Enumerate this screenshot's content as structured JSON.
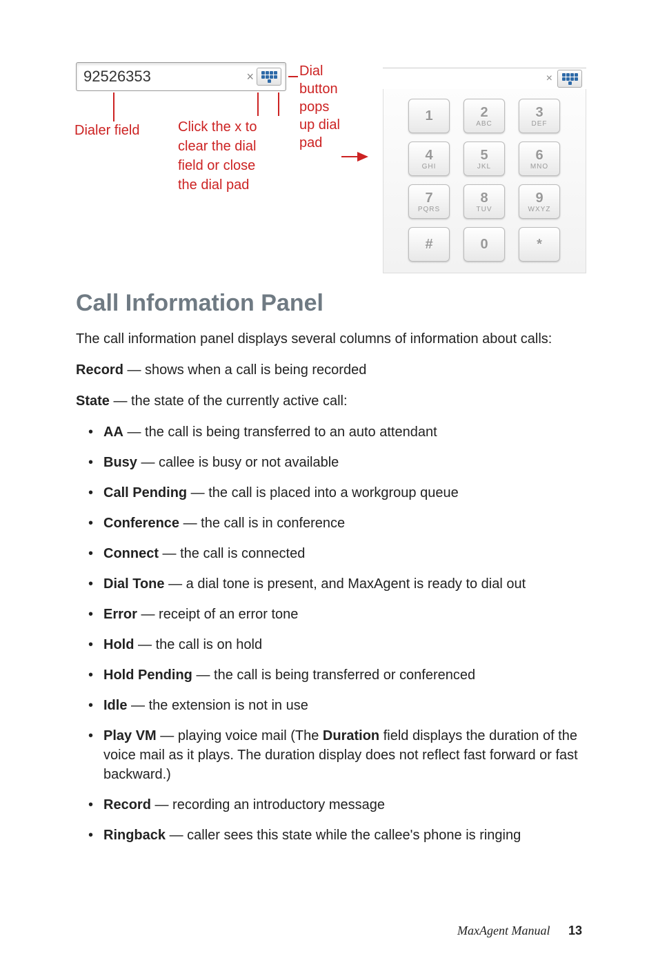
{
  "dialer": {
    "value": "92526353",
    "clear_glyph": "×"
  },
  "labels": {
    "dialer_field": "Dialer field",
    "click_x": "Click the x to clear the dial field or close the dial pad",
    "dial_button": "Dial button pops up dial pad"
  },
  "keypad": {
    "close_glyph": "×",
    "keys": [
      {
        "num": "1",
        "ltr": ""
      },
      {
        "num": "2",
        "ltr": "ABC"
      },
      {
        "num": "3",
        "ltr": "DEF"
      },
      {
        "num": "4",
        "ltr": "GHI"
      },
      {
        "num": "5",
        "ltr": "JKL"
      },
      {
        "num": "6",
        "ltr": "MNO"
      },
      {
        "num": "7",
        "ltr": "PQRS"
      },
      {
        "num": "8",
        "ltr": "TUV"
      },
      {
        "num": "9",
        "ltr": "WXYZ"
      },
      {
        "num": "#",
        "ltr": ""
      },
      {
        "num": "0",
        "ltr": ""
      },
      {
        "num": "*",
        "ltr": ""
      }
    ]
  },
  "section_heading": "Call Information Panel",
  "intro": "The call information panel displays several columns of information about calls:",
  "record_line": {
    "term": "Record",
    "dash": " — ",
    "desc": "shows when a call is being recorded"
  },
  "state_line": {
    "term": "State",
    "dash": " — ",
    "desc": "the state of the currently active call:"
  },
  "states": [
    {
      "term": "AA",
      "desc": "the call is being transferred to an auto attendant"
    },
    {
      "term": "Busy",
      "desc": "callee is busy or not available"
    },
    {
      "term": "Call Pending",
      "desc": "the call is placed into a workgroup queue"
    },
    {
      "term": "Conference",
      "desc": "the call is in conference"
    },
    {
      "term": "Connect",
      "desc": "the call is connected"
    },
    {
      "term": "Dial Tone",
      "desc": "a dial tone is present, and MaxAgent is ready to dial out"
    },
    {
      "term": "Error",
      "desc": "receipt of an error tone"
    },
    {
      "term": "Hold",
      "desc": "the call is on hold"
    },
    {
      "term": "Hold Pending",
      "desc": "the call is being transferred or conferenced"
    },
    {
      "term": "Idle",
      "desc": "the extension is not in use"
    },
    {
      "term": "Play VM",
      "desc_pre": "playing voice mail (The ",
      "bold": "Duration",
      "desc_post": " field displays the duration of the voice mail as it plays. The duration display does not reflect fast forward or fast backward.)"
    },
    {
      "term": "Record",
      "desc": "recording an introductory message"
    },
    {
      "term": "Ringback",
      "desc": "caller sees this state while the callee's phone is ringing"
    }
  ],
  "dash": " — ",
  "footer": {
    "title": "MaxAgent Manual",
    "page": "13"
  }
}
